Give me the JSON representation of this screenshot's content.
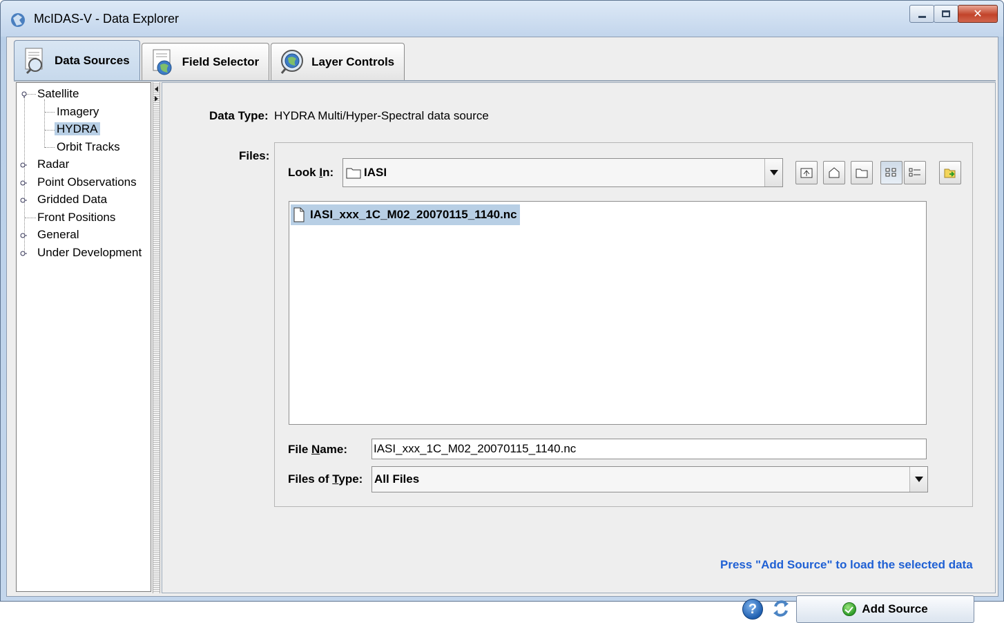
{
  "window": {
    "title": "McIDAS-V - Data Explorer"
  },
  "tabs": [
    {
      "label": "Data Sources",
      "icon": "magnifier-document-icon"
    },
    {
      "label": "Field Selector",
      "icon": "globe-document-icon"
    },
    {
      "label": "Layer Controls",
      "icon": "globe-magnifier-icon"
    }
  ],
  "tree": {
    "items": [
      {
        "label": "Satellite",
        "expanded": true
      },
      {
        "label": "Imagery"
      },
      {
        "label": "HYDRA",
        "selected": true
      },
      {
        "label": "Orbit Tracks"
      },
      {
        "label": "Radar"
      },
      {
        "label": "Point Observations"
      },
      {
        "label": "Gridded Data"
      },
      {
        "label": "Front Positions"
      },
      {
        "label": "General"
      },
      {
        "label": "Under Development"
      }
    ]
  },
  "data_type": {
    "label": "Data Type:",
    "value": "HYDRA Multi/Hyper-Spectral data source"
  },
  "files": {
    "label": "Files:",
    "look_in_label_pre": "Look ",
    "look_in_label_mn": "I",
    "look_in_label_post": "n:",
    "look_in_value": "IASI",
    "list": [
      "IASI_xxx_1C_M02_20070115_1140.nc"
    ],
    "file_name_label_pre": "File ",
    "file_name_label_mn": "N",
    "file_name_label_post": "ame:",
    "file_name_value": "IASI_xxx_1C_M02_20070115_1140.nc",
    "files_of_type_label_pre": "Files of ",
    "files_of_type_label_mn": "T",
    "files_of_type_label_post": "ype:",
    "files_of_type_value": "All Files"
  },
  "hint": "Press \"Add Source\" to load the selected data",
  "add_source_label": "Add Source",
  "help_glyph": "?",
  "colors": {
    "hint": "#1f60d4",
    "selection": "#b8cfe5"
  }
}
